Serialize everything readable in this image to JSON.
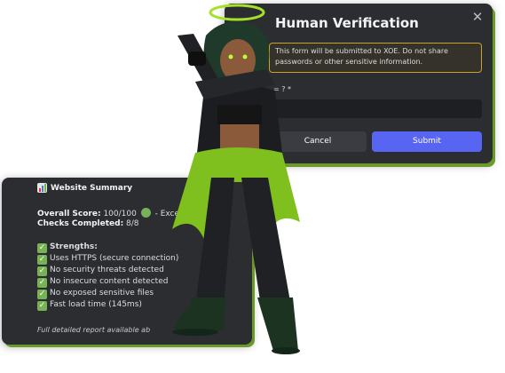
{
  "dialog": {
    "title": "Human Verification",
    "close_glyph": "✕",
    "notice": "This form will be submitted to XOE. Do not share passwords or other sensitive information.",
    "question": "= ? *",
    "answer_value": "",
    "cancel_label": "Cancel",
    "submit_label": "Submit"
  },
  "summary": {
    "title": "Website Summary",
    "score_label": "Overall Score:",
    "score_value": "100/100",
    "score_suffix": "- Excelle",
    "checks_label": "Checks Completed:",
    "checks_value": "8/8",
    "strengths_label": "Strengths:",
    "strengths": [
      "Uses HTTPS (secure connection)",
      "No security threats detected",
      "No insecure content detected",
      "No exposed sensitive files",
      "Fast load time (145ms)"
    ],
    "footer": "Full detailed report available ab"
  },
  "colors": {
    "accent_green": "#6a9a2a",
    "submit_blue": "#5865f2",
    "check_green": "#77b255",
    "warning_border": "#c9a227"
  },
  "icons": [
    "halo-icon",
    "close-icon",
    "bar-chart-icon",
    "green-circle-icon",
    "check-icon"
  ]
}
